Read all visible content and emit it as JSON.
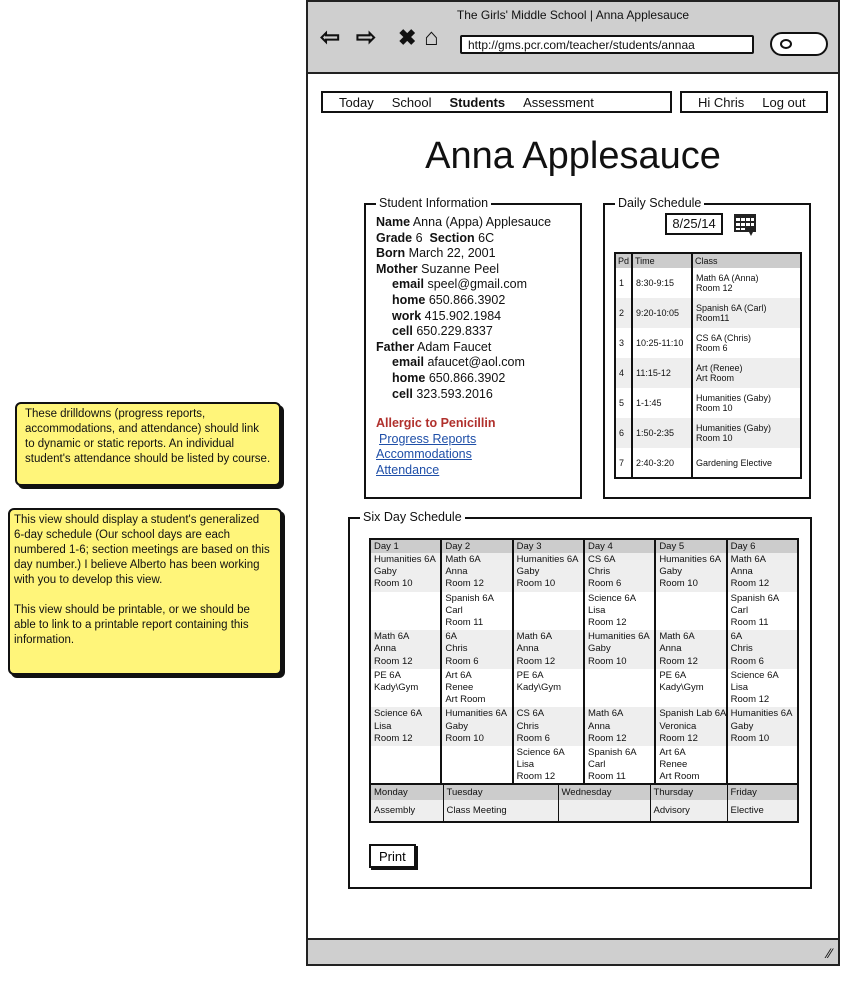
{
  "notes": [
    "These drilldowns (progress reports, accommodations, and attendance) should link to dynamic or static reports. An individual student's attendance should be listed by course.",
    "This view should display a student's generalized 6-day schedule (Our school days are each numbered 1-6; section meetings are based on this day number.) I believe Alberto has been working with you to develop this view.\n\nThis view should be printable, or we should be able to link to a printable report containing this information."
  ],
  "browser": {
    "title": "The Girls' Middle School | Anna Applesauce",
    "url": "http://gms.pcr.com/teacher/students/annaa"
  },
  "nav": {
    "items": [
      "Today",
      "School",
      "Students",
      "Assessment"
    ],
    "greeting": "Hi Chris",
    "logout": "Log out"
  },
  "page_title": "Anna Applesauce",
  "info": {
    "legend": "Student Information",
    "name_l": "Name",
    "name": "Anna (Appa) Applesauce",
    "grade_l": "Grade",
    "grade": "6",
    "section_l": "Section",
    "section": "6C",
    "born_l": "Born",
    "born": "March 22, 2001",
    "mother_l": "Mother",
    "mother": "Suzanne Peel",
    "m_email": "speel@gmail.com",
    "m_home": "650.866.3902",
    "m_work": "415.902.1984",
    "m_cell": "650.229.8337",
    "father_l": "Father",
    "father": "Adam Faucet",
    "f_email": "afaucet@aol.com",
    "f_home": "650.866.3902",
    "f_cell": "323.593.2016",
    "email_l": "email",
    "home_l": "home",
    "work_l": "work",
    "cell_l": "cell",
    "allergy": "Allergic to Penicillin",
    "links": [
      "Progress Reports",
      "Accommodations",
      "Attendance"
    ]
  },
  "daily": {
    "legend": "Daily Schedule",
    "date": "8/25/14",
    "headers": [
      "Pd",
      "Time",
      "Class"
    ],
    "rows": [
      [
        "1",
        "8:30-9:15",
        "Math 6A (Anna)",
        "Room 12"
      ],
      [
        "2",
        "9:20-10:05",
        "Spanish 6A (Carl)",
        "Room11"
      ],
      [
        "3",
        "10:25-11:10",
        "CS 6A (Chris)",
        "Room 6"
      ],
      [
        "4",
        "11:15-12",
        "Art (Renee)",
        "Art Room"
      ],
      [
        "5",
        "1-1:45",
        "Humanities (Gaby)",
        "Room 10"
      ],
      [
        "6",
        "1:50-2:35",
        "Humanities (Gaby)",
        "Room 10"
      ],
      [
        "7",
        "2:40-3:20",
        "Gardening Elective",
        ""
      ]
    ]
  },
  "six": {
    "legend": "Six Day Schedule",
    "headers": [
      "Day 1",
      "Day 2",
      "Day 3",
      "Day 4",
      "Day 5",
      "Day 6"
    ],
    "rows": [
      [
        [
          "Humanities 6A",
          "Gaby",
          "Room 10"
        ],
        [
          "Math 6A",
          "Anna",
          "Room 12"
        ],
        [
          "Humanities 6A",
          "Gaby",
          "Room 10"
        ],
        [
          "CS 6A",
          "Chris",
          "Room 6"
        ],
        [
          "Humanities 6A",
          "Gaby",
          "Room 10"
        ],
        [
          "Math 6A",
          "Anna",
          "Room 12"
        ]
      ],
      [
        [],
        [
          "Spanish 6A",
          "Carl",
          "Room 11"
        ],
        [],
        [
          "Science 6A",
          "Lisa",
          "Room 12"
        ],
        [],
        [
          "Spanish 6A",
          "Carl",
          "Room 11"
        ]
      ],
      [
        [
          "Math 6A",
          "Anna",
          "Room 12"
        ],
        [
          "6A",
          "Chris",
          "Room 6"
        ],
        [
          "Math 6A",
          "Anna",
          "Room 12"
        ],
        [
          "Humanities 6A",
          "Gaby",
          "Room 10"
        ],
        [
          "Math 6A",
          "Anna",
          "Room 12"
        ],
        [
          "6A",
          "Chris",
          "Room 6"
        ]
      ],
      [
        [
          "PE 6A",
          "Kady\\Gym"
        ],
        [
          "Art 6A",
          "Renee",
          "Art Room"
        ],
        [
          "PE 6A",
          "Kady\\Gym"
        ],
        [],
        [
          "PE 6A",
          "Kady\\Gym"
        ],
        [
          "Science 6A",
          "Lisa",
          "Room 12"
        ]
      ],
      [
        [
          "Science 6A",
          "Lisa",
          "Room 12"
        ],
        [
          "Humanities 6A",
          "Gaby",
          "Room 10"
        ],
        [
          "CS 6A",
          "Chris",
          "Room 6"
        ],
        [
          "Math 6A",
          "Anna",
          "Room 12"
        ],
        [
          "Spanish Lab 6A",
          "Veronica",
          "Room 12"
        ],
        [
          "Humanities 6A",
          "Gaby",
          "Room 10"
        ]
      ],
      [
        [],
        [],
        [
          "Science 6A",
          "Lisa",
          "Room 12"
        ],
        [
          "Spanish 6A",
          "Carl",
          "Room 11"
        ],
        [
          "Art 6A",
          "Renee",
          "Art Room"
        ],
        []
      ]
    ]
  },
  "weekly": {
    "headers": [
      "Monday",
      "Tuesday",
      "Wednesday",
      "Thursday",
      "Friday"
    ],
    "values": [
      "Assembly",
      "Class Meeting",
      "",
      "Advisory",
      "Elective"
    ]
  },
  "print_label": "Print",
  "colors": {
    "note": "#fff57a",
    "allergy": "#b0302c",
    "link": "#1f4fa8",
    "chrome": "#cfcfcf"
  },
  "icons": [
    "back-arrow-icon",
    "forward-arrow-icon",
    "close-icon",
    "home-icon",
    "search-icon",
    "calendar-icon",
    "resize-grip-icon"
  ]
}
